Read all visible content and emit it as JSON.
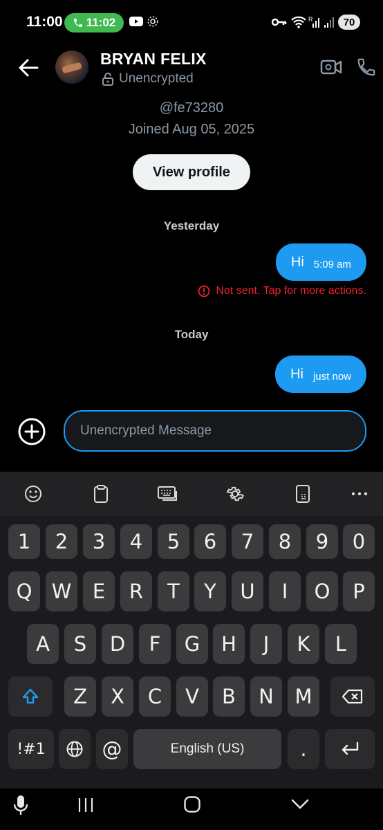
{
  "status_bar": {
    "time": "11:00",
    "call_time": "11:02",
    "battery": "70",
    "icons": [
      "phone-icon",
      "youtube-icon",
      "settings-gear-icon",
      "key-icon",
      "wifi-icon",
      "signal-icon"
    ]
  },
  "header": {
    "name": "BRYAN FELIX",
    "encryption": "Unencrypted",
    "icons": [
      "back-arrow-icon",
      "video-call-icon",
      "phone-icon",
      "lock-open-icon"
    ]
  },
  "profile": {
    "handle": "@fe73280",
    "joined": "Joined Aug 05, 2025",
    "view_profile": "View profile"
  },
  "conversation": {
    "days": [
      "Yesterday",
      "Today"
    ],
    "messages": [
      {
        "text": "Hi",
        "time": "5:09 am",
        "status": "Not sent. Tap for more actions."
      },
      {
        "text": "Hi",
        "time": "just now"
      }
    ]
  },
  "composer": {
    "placeholder": "Unencrypted Message",
    "value": ""
  },
  "keyboard": {
    "toolbar": [
      "emoji-icon",
      "clipboard-icon",
      "keyboard-mode-icon",
      "settings-icon",
      "one-handed-icon",
      "more-icon"
    ],
    "row_numbers": [
      "1",
      "2",
      "3",
      "4",
      "5",
      "6",
      "7",
      "8",
      "9",
      "0"
    ],
    "row_q": [
      "Q",
      "W",
      "E",
      "R",
      "T",
      "Y",
      "U",
      "I",
      "O",
      "P"
    ],
    "row_a": [
      "A",
      "S",
      "D",
      "F",
      "G",
      "H",
      "J",
      "K",
      "L"
    ],
    "row_z": [
      "Z",
      "X",
      "C",
      "V",
      "B",
      "N",
      "M"
    ],
    "symbols": "!#1",
    "at": "@",
    "space": "English (US)",
    "period": "."
  },
  "colors": {
    "accent": "#1d9bf0",
    "error": "#f4212e",
    "call_green": "#3fb950",
    "background": "#000000"
  }
}
